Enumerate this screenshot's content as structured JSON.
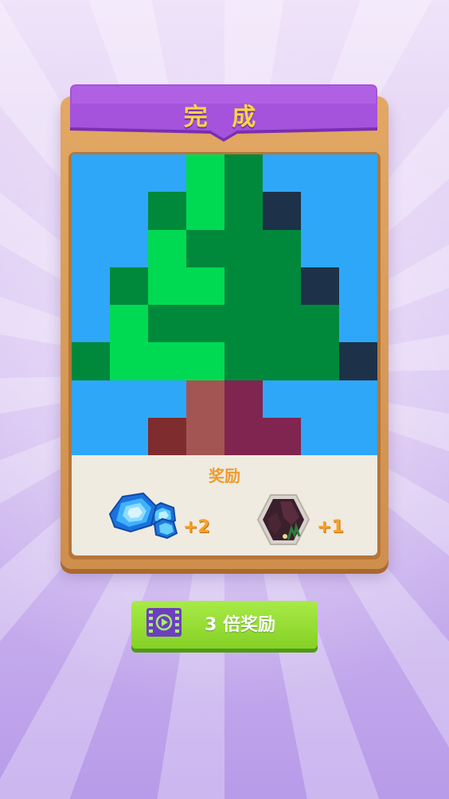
{
  "dialog": {
    "title": "完 成",
    "pixel_grid": [
      [
        "#2fa7f8",
        "#2fa7f8",
        "#2fa7f8",
        "#00da53",
        "#00893b",
        "#2fa7f8",
        "#2fa7f8",
        "#2fa7f8"
      ],
      [
        "#2fa7f8",
        "#2fa7f8",
        "#00893b",
        "#00da53",
        "#00893b",
        "#1d3248",
        "#2fa7f8",
        "#2fa7f8"
      ],
      [
        "#2fa7f8",
        "#2fa7f8",
        "#00da53",
        "#00893b",
        "#00893b",
        "#00893b",
        "#2fa7f8",
        "#2fa7f8"
      ],
      [
        "#2fa7f8",
        "#00893b",
        "#00da53",
        "#00da53",
        "#00893b",
        "#00893b",
        "#1d3248",
        "#2fa7f8"
      ],
      [
        "#2fa7f8",
        "#00da53",
        "#00893b",
        "#00893b",
        "#00893b",
        "#00893b",
        "#00893b",
        "#2fa7f8"
      ],
      [
        "#00893b",
        "#00da53",
        "#00da53",
        "#00da53",
        "#00893b",
        "#00893b",
        "#00893b",
        "#1d3248"
      ],
      [
        "#2fa7f8",
        "#2fa7f8",
        "#2fa7f8",
        "#a35553",
        "#802550",
        "#2fa7f8",
        "#2fa7f8",
        "#2fa7f8"
      ],
      [
        "#2fa7f8",
        "#2fa7f8",
        "#7f2c2e",
        "#a35553",
        "#802550",
        "#802550",
        "#2fa7f8",
        "#2fa7f8"
      ]
    ],
    "reward": {
      "title": "奖励",
      "items": [
        {
          "icon": "blue-gems-icon",
          "count": "+2"
        },
        {
          "icon": "puzzle-tile-icon",
          "count": "+1"
        }
      ]
    }
  },
  "triple_reward_button": {
    "icon": "video-play-icon",
    "label": "3 倍奖励"
  },
  "colors": {
    "banner": "#9a44d4",
    "button": "#93dc35",
    "wood": "#d9995a",
    "reward_text": "#f09a2c"
  }
}
